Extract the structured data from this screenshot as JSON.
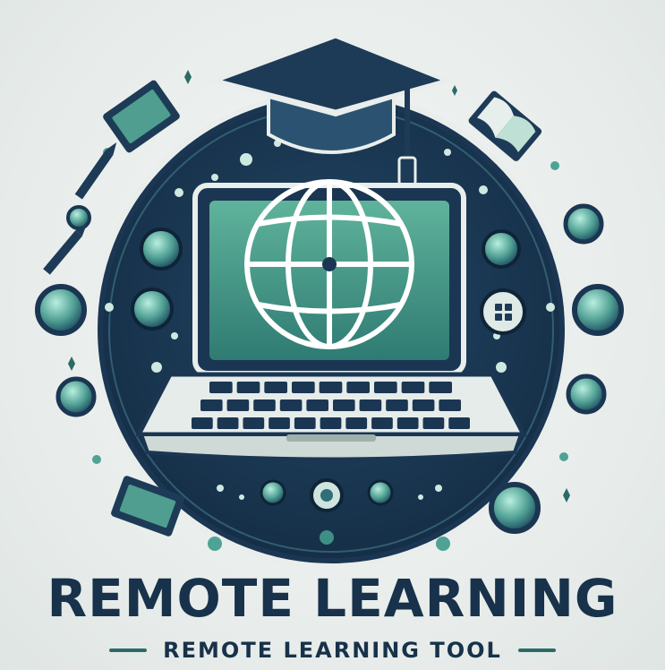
{
  "logo": {
    "title": "REMOTE LEARNING",
    "subtitle": "REMOTE LEARNING TOOL"
  },
  "colors": {
    "navy": "#1d3b57",
    "teal": "#3d8f86",
    "mint": "#6fc3a8",
    "background": "#e9eeec"
  },
  "icons": [
    "graduation-cap-icon",
    "globe-icon",
    "laptop-icon",
    "book-icon",
    "pencil-icon",
    "gear-icon"
  ]
}
